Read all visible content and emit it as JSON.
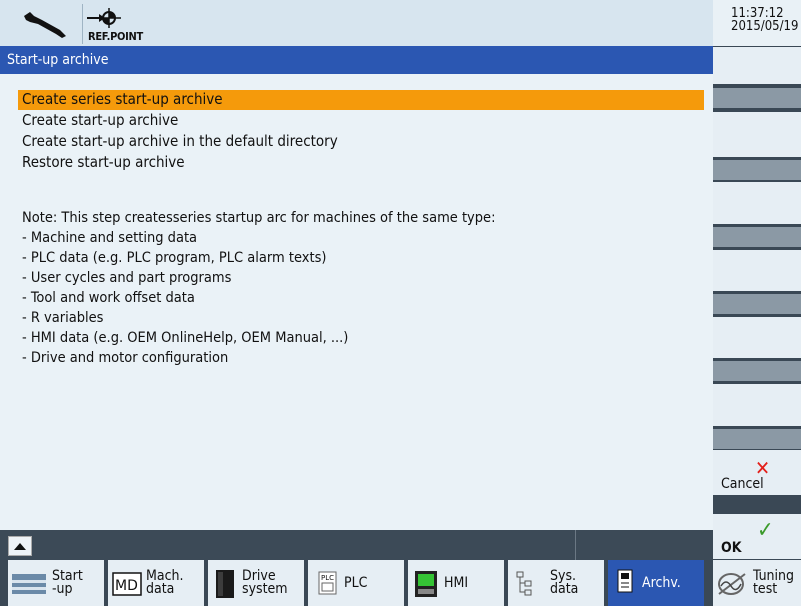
{
  "header": {
    "refpoint_label": "REF.POINT",
    "time": "11:37:12",
    "date": "2015/05/19"
  },
  "title": "Start-up archive",
  "menu": [
    "Create series start-up archive",
    "Create start-up archive",
    "Create start-up archive in the default directory",
    "Restore start-up archive"
  ],
  "note": {
    "heading": "Note: This step createsseries startup arc for machines of the same type:",
    "items": [
      "- Machine and setting data",
      "- PLC data (e.g. PLC program, PLC alarm texts)",
      "- User cycles and part programs",
      "- Tool and work offset data",
      "- R variables",
      "- HMI data (e.g. OEM OnlineHelp, OEM Manual, ...)",
      "- Drive and motor configuration"
    ]
  },
  "vertical_keys": {
    "cancel": "Cancel",
    "ok": "OK"
  },
  "horizontal_keys": [
    {
      "label": "Start\n-up",
      "icon": "startup-icon"
    },
    {
      "label": "Mach.\ndata",
      "icon": "md-icon"
    },
    {
      "label": "Drive\nsystem",
      "icon": "drive-icon"
    },
    {
      "label": "PLC",
      "icon": "plc-icon"
    },
    {
      "label": "HMI",
      "icon": "hmi-icon"
    },
    {
      "label": "Sys.\ndata",
      "icon": "sysdata-icon"
    },
    {
      "label": "Archv.",
      "icon": "archive-icon"
    },
    {
      "label": "Tuning\ntest",
      "icon": "tuning-icon"
    }
  ],
  "colors": {
    "selection": "#f59a0b",
    "titlebar": "#2b57b2",
    "cancel_x": "#e3201b",
    "ok_check": "#3a9a2a"
  }
}
